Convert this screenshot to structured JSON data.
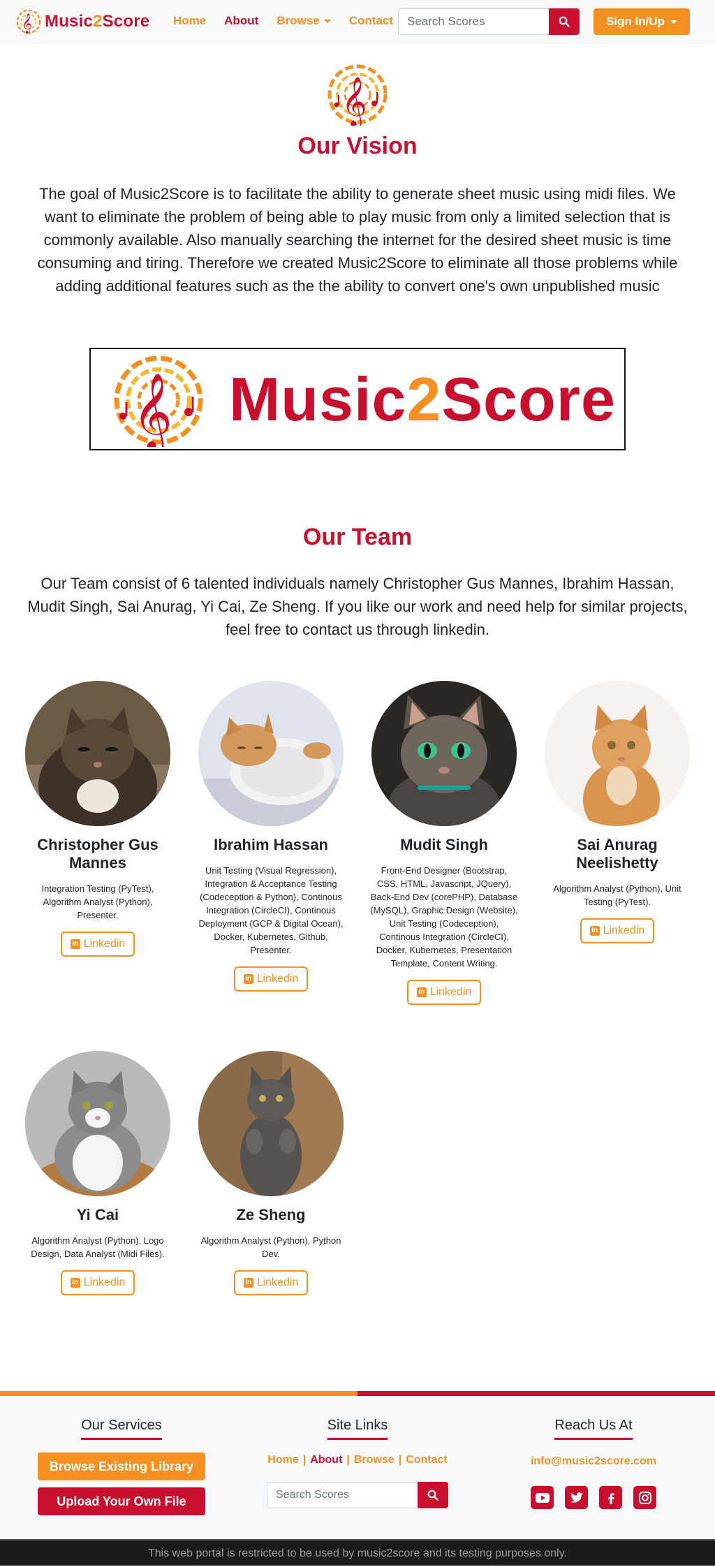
{
  "navbar": {
    "brand_prefix": "Music",
    "brand_two": "2",
    "brand_suffix": "Score",
    "links": [
      {
        "label": "Home",
        "active": false
      },
      {
        "label": "About",
        "active": true
      },
      {
        "label": "Browse",
        "active": false,
        "dropdown": true
      },
      {
        "label": "Contact",
        "active": false
      }
    ],
    "search_placeholder": "Search Scores",
    "sign_label": "Sign In/Up"
  },
  "vision": {
    "title": "Our Vision",
    "text": "The goal of Music2Score is to facilitate the ability to generate sheet music using midi files. We want to eliminate the problem of being able to play music from only a limited selection that is commonly available. Also manually searching the internet for the desired sheet music is time consuming and tiring. Therefore we created Music2Score to eliminate all those problems while adding additional features such as the the ability to convert one's own unpublished music"
  },
  "banner": {
    "prefix": "Music",
    "two": "2",
    "suffix": "Score"
  },
  "team": {
    "title": "Our Team",
    "text": "Our Team consist of 6 talented individuals namely Christopher Gus Mannes, Ibrahim Hassan, Mudit Singh, Sai Anurag, Yi Cai, Ze Sheng. If you like our work and need help for similar projects, feel free to contact us through linkedin.",
    "linkedin_label": "Linkedin",
    "members": [
      {
        "name": "Christopher Gus Mannes",
        "role": "Integration Testing (PyTest), Algorithm Analyst (Python), Presenter."
      },
      {
        "name": "Ibrahim Hassan",
        "role": "Unit Testing (Visual Regression), Integration & Acceptance Testing (Codeception & Python), Continous Integration (CircleCI), Continous Deployment (GCP & Digital Ocean), Docker, Kubernetes, Github, Presenter."
      },
      {
        "name": "Mudit Singh",
        "role": "Front-End Designer (Bootstrap, CSS, HTML, Javascript, JQuery), Back-End Dev (corePHP), Database (MySQL), Graphic Design (Website), Unit Testing (Codeception), Continous Integration (CircleCI), Docker, Kubernetes, Presentation Template, Content Writing."
      },
      {
        "name": "Sai Anurag Neelishetty",
        "role": "Algorithm Analyst (Python), Unit Testing (PyTest)."
      },
      {
        "name": "Yi Cai",
        "role": "Algorithm Analyst (Python), Logo Design, Data Analyst (Midi Files)."
      },
      {
        "name": "Ze Sheng",
        "role": "Algorithm Analyst (Python), Python Dev."
      }
    ]
  },
  "footer": {
    "services_heading": "Our Services",
    "browse_btn": "Browse Existing Library",
    "upload_btn": "Upload Your Own File",
    "links_heading": "Site Links",
    "links": [
      "Home",
      "About",
      "Browse",
      "Contact"
    ],
    "search_placeholder": "Search Scores",
    "reach_heading": "Reach Us At",
    "email": "info@music2score.com",
    "social": [
      "youtube-icon",
      "twitter-icon",
      "facebook-icon",
      "instagram-icon"
    ]
  },
  "bottom_text": "This web portal is restricted to be used by music2score and its testing purposes only.",
  "colors": {
    "brand_red": "#c8102e",
    "brand_orange": "#f39021"
  }
}
